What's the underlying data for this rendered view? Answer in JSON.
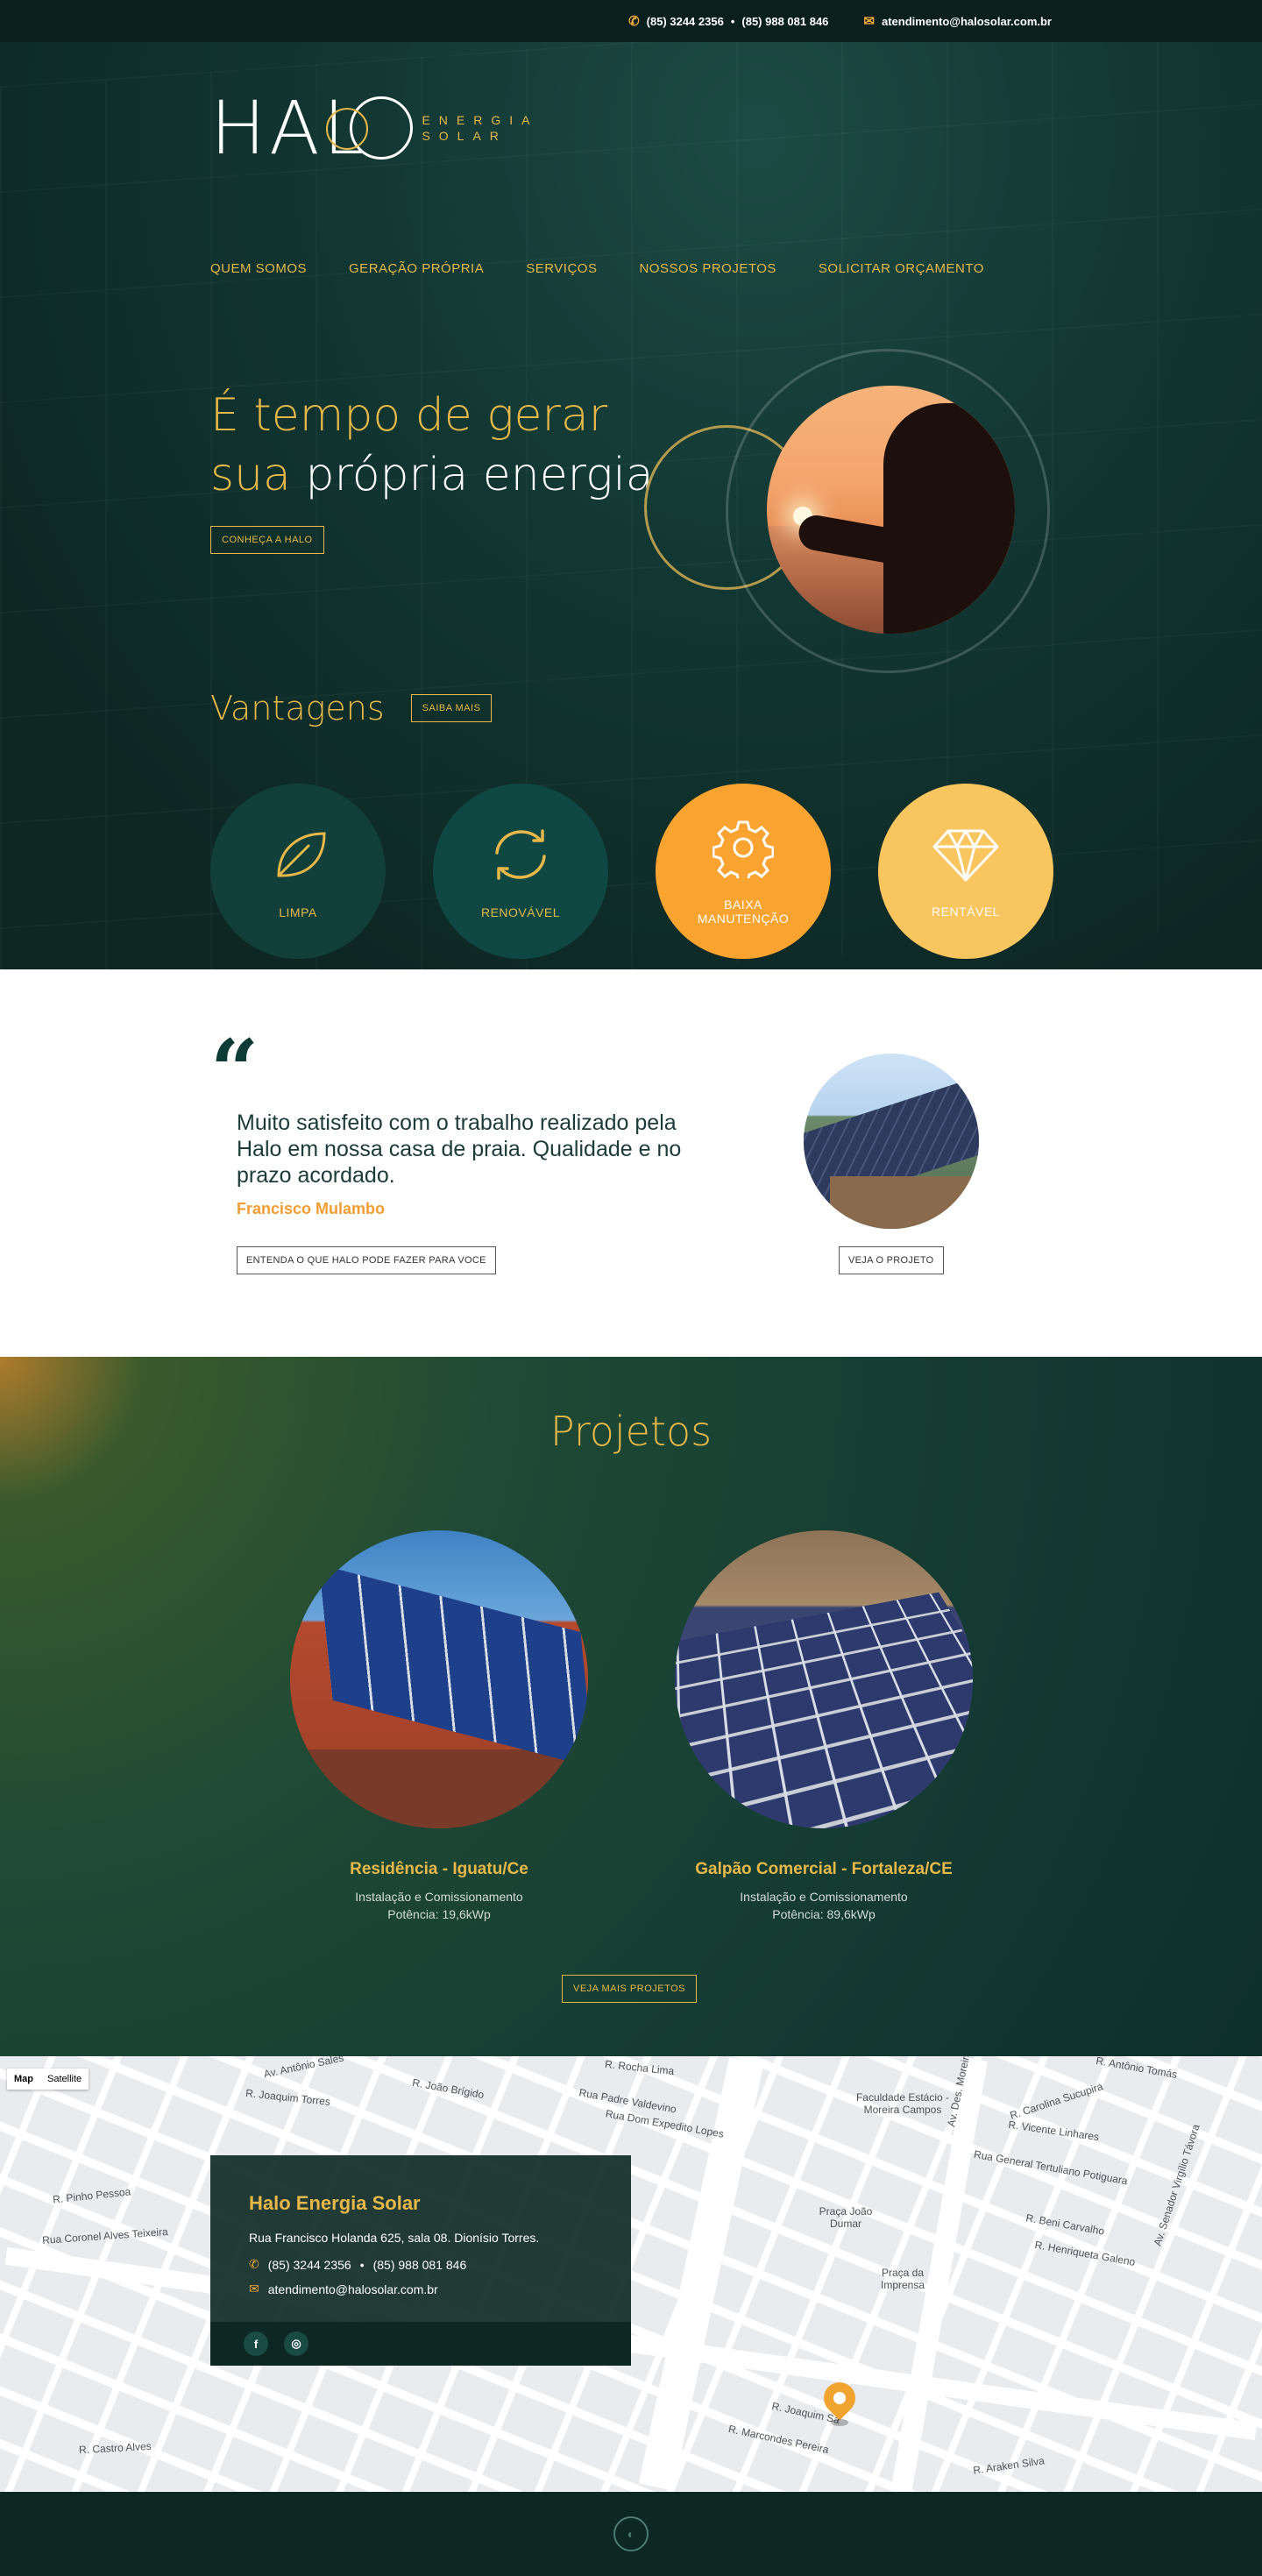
{
  "topbar": {
    "phone1": "(85) 3244 2356",
    "phone2": "(85) 988 081 846",
    "email": "atendimento@halosolar.com.br",
    "phone_icon": "phone-icon",
    "mail_icon": "mail-icon"
  },
  "logo": {
    "word": "HAL",
    "sub1": "ENERGIA",
    "sub2": "SOLAR"
  },
  "nav": [
    "QUEM SOMOS",
    "GERAÇÃO PRÓPRIA",
    "SERVIÇOS",
    "NOSSOS PROJETOS",
    "SOLICITAR ORÇAMENTO"
  ],
  "hero": {
    "line1": "É tempo de gerar",
    "line2a": "sua",
    "line2b": "própria energia",
    "cta": "CONHEÇA A HALO"
  },
  "advantages": {
    "title": "Vantagens",
    "cta": "SAIBA MAIS",
    "items": [
      {
        "label": "LIMPA",
        "icon": "leaf-icon"
      },
      {
        "label": "RENOVÁVEL",
        "icon": "refresh-icon"
      },
      {
        "label": "BAIXA MANUTENÇÃO",
        "icon": "gear-icon"
      },
      {
        "label": "RENTÁVEL",
        "icon": "diamond-icon"
      }
    ]
  },
  "testimonial": {
    "text": "Muito satisfeito com o trabalho realizado pela Halo em nossa casa de praia. Qualidade e no prazo acordado.",
    "author": "Francisco Mulambo",
    "cta_left": "ENTENDA O QUE HALO PODE FAZER PARA VOCE",
    "cta_right": "VEJA O PROJETO"
  },
  "projects": {
    "title": "Projetos",
    "items": [
      {
        "title": "Residência - Iguatu/Ce",
        "line1": "Instalação e Comissionamento",
        "line2": "Potência: 19,6kWp"
      },
      {
        "title": "Galpão Comercial - Fortaleza/CE",
        "line1": "Instalação e Comissionamento",
        "line2": "Potência: 89,6kWp"
      }
    ],
    "cta": "VEJA MAIS PROJETOS"
  },
  "map": {
    "tab_map": "Map",
    "tab_sat": "Satellite",
    "streets": [
      "Av. Antônio Sales",
      "R. Rocha Lima",
      "R. Antônio Tomás",
      "R. Joaquim Torres",
      "R. João Brígido",
      "Rua Padre Valdevino",
      "Faculdade Estácio - Moreira Campos",
      "R. Carolina Sucupira",
      "R. Vicente Linhares",
      "Rua General Tertuliano Potiguara",
      "R. Pinho Pessoa",
      "Rua Coronel Alves Teixeira",
      "Praça João Dumar",
      "R. Beni Carvalho",
      "R. Henriqueta Galeno",
      "Praça da Imprensa",
      "R. Joaquim Sá",
      "R. Marcondes Pereira",
      "R. Castro Alves",
      "Av. Des. Moreira",
      "Rua Dom Expedito Lopes",
      "Av. Senador Virgílio Távora",
      "R. Araken Silva"
    ],
    "info": {
      "name": "Halo Energia Solar",
      "address": "Rua Francisco Holanda 625, sala 08. Dionísio Torres.",
      "phone1": "(85) 3244 2356",
      "phone2": "(85) 988 081 846",
      "email": "atendimento@halosolar.com.br",
      "social": [
        "facebook-icon",
        "instagram-icon"
      ]
    }
  },
  "colors": {
    "gold": "#e6b84a",
    "orange": "#f9a431",
    "yellow": "#f8c55f",
    "dark": "#0f2a26"
  }
}
